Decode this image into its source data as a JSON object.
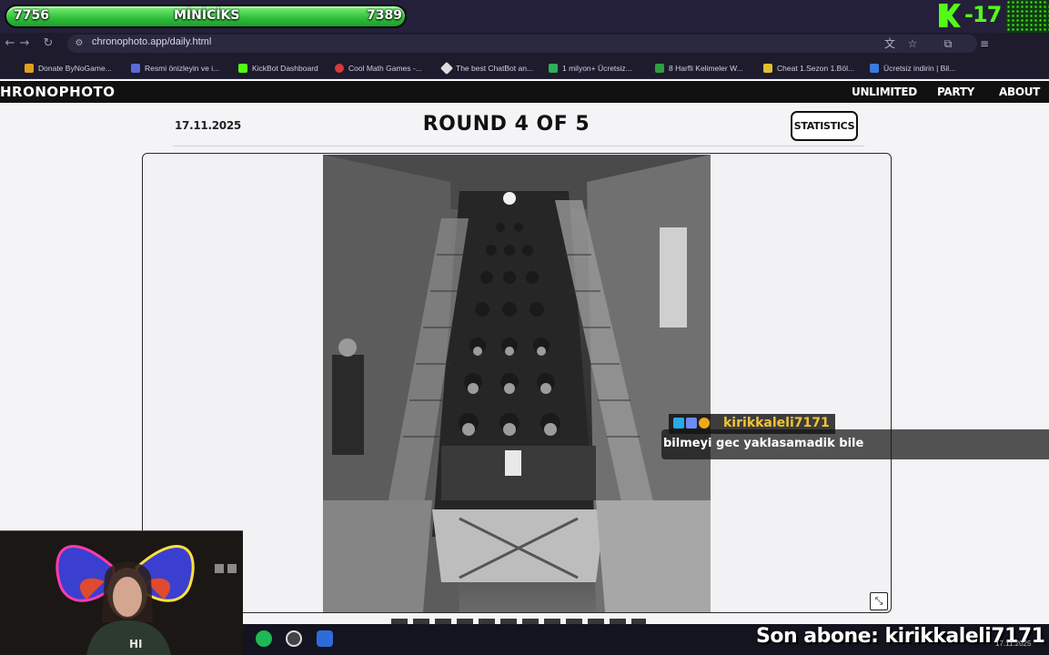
{
  "overlay": {
    "hp_left": "7756",
    "hp_name": "MİNİCİKS",
    "hp_right": "7389",
    "kick_count": "-17"
  },
  "browser": {
    "url": "chronophoto.app/daily.html",
    "bookmarks": [
      "Donate ByNoGame...",
      "Resmi önizleyin ve i...",
      "KickBot Dashboard",
      "Cool Math Games -...",
      "The best ChatBot an...",
      "1 milyon+ Ücretsiz...",
      "8 Harfli Kelimeler W...",
      "Cheat 1.Sezon 1.Böl...",
      "Ücretsiz indirin | Bil..."
    ]
  },
  "site": {
    "logo": "HRONOPHOTO",
    "nav": [
      "UNLIMITED",
      "PARTY",
      "ABOUT"
    ]
  },
  "game": {
    "date": "17.11.2025",
    "round_title": "ROUND 4 OF 5",
    "statistics_label": "STATISTICS"
  },
  "chat": {
    "username": "kirikkaleli7171",
    "message": "bilmeyi gec yaklasamadik bile"
  },
  "stream": {
    "last_sub": "Son abone: kirikkaleli7171",
    "tray_date": "17.11.2025"
  },
  "colors": {
    "accent_green": "#53fc18",
    "username_color": "#f2c335",
    "header_bg": "#111111"
  }
}
